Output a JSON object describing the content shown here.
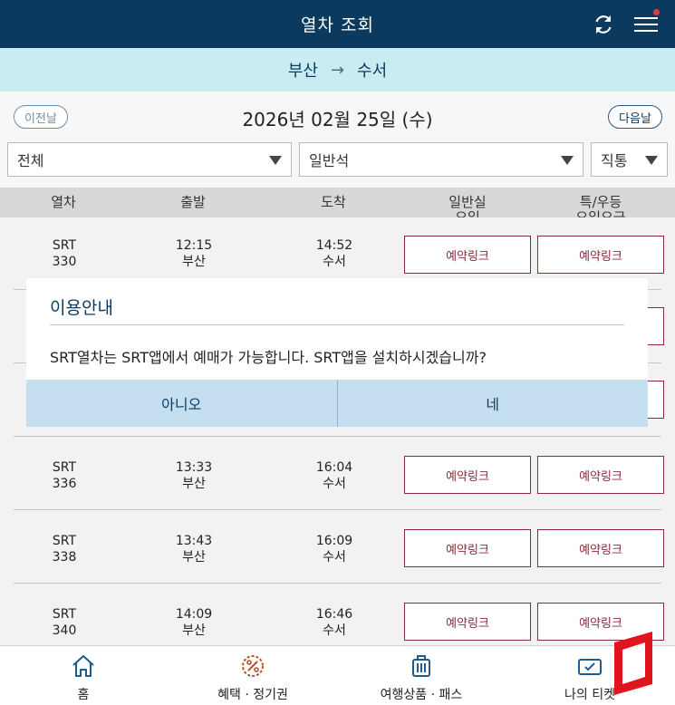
{
  "header": {
    "title": "열차 조회",
    "refresh_icon": "refresh-icon",
    "menu_icon": "hamburger-menu-icon"
  },
  "route": {
    "from": "부산",
    "arrow": "→",
    "to": "수서"
  },
  "date_nav": {
    "prev_label": "이전날",
    "date": "2026년 02월 25일 (수)",
    "next_label": "다음날"
  },
  "filters": {
    "train_type": "전체",
    "seat_class": "일반석",
    "direct": "직통"
  },
  "columns": [
    "열차",
    "출발",
    "도착",
    "일반실\n요일",
    "특/우등\n요일요금"
  ],
  "trains": [
    {
      "name": "SRT",
      "number": "330",
      "dep_time": "12:15",
      "dep_station": "부산",
      "arr_time": "14:52",
      "arr_station": "수서",
      "general": "예약링크",
      "special": "예약링크"
    },
    {
      "name": "",
      "number": "",
      "dep_time": "",
      "dep_station": "",
      "arr_time": "",
      "arr_station": "",
      "general": "",
      "special": ""
    },
    {
      "name": "",
      "number": "",
      "dep_time": "",
      "dep_station": "",
      "arr_time": "",
      "arr_station": "",
      "general": "",
      "special": ""
    },
    {
      "name": "SRT",
      "number": "336",
      "dep_time": "13:33",
      "dep_station": "부산",
      "arr_time": "16:04",
      "arr_station": "수서",
      "general": "예약링크",
      "special": "예약링크"
    },
    {
      "name": "SRT",
      "number": "338",
      "dep_time": "13:43",
      "dep_station": "부산",
      "arr_time": "16:09",
      "arr_station": "수서",
      "general": "예약링크",
      "special": "예약링크"
    },
    {
      "name": "SRT",
      "number": "340",
      "dep_time": "14:09",
      "dep_station": "부산",
      "arr_time": "16:46",
      "arr_station": "수서",
      "general": "예약링크",
      "special": "예약링크"
    }
  ],
  "dialog": {
    "title": "이용안내",
    "message": "SRT열차는 SRT앱에서 예매가 가능합니다. SRT앱을 설치하시겠습니까?",
    "no_label": "아니오",
    "yes_label": "네"
  },
  "tabbar": [
    {
      "label": "홈",
      "icon": "home-icon"
    },
    {
      "label": "혜택 · 정기권",
      "icon": "discount-badge-icon"
    },
    {
      "label": "여행상품 · 패스",
      "icon": "luggage-icon"
    },
    {
      "label": "나의 티켓",
      "icon": "ticket-icon"
    }
  ],
  "colors": {
    "primary": "#0b3a5e",
    "route_bg": "#c9ecf3",
    "button_border": "#8a2a3a",
    "dialog_buttons_bg": "#c6dff0",
    "tab_icon": "#1f5c8c",
    "benefit_icon": "#b5532a",
    "corner_badge": "#e0141e"
  }
}
